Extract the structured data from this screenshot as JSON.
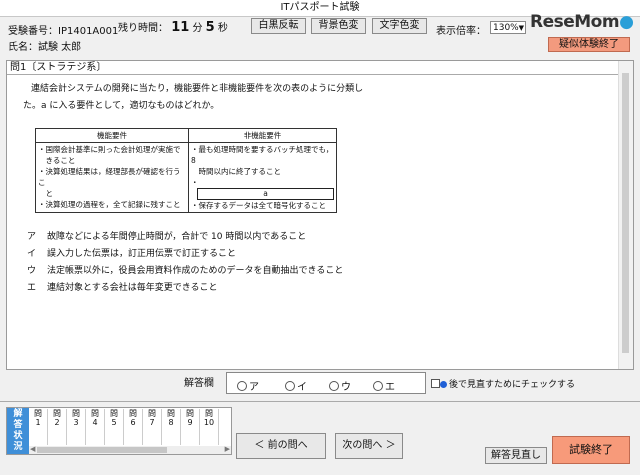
{
  "window": {
    "title": "ITパスポート試験"
  },
  "header": {
    "exam_id_label": "受験番号：",
    "exam_id_value": "IP1401A001",
    "time_label": "残り時間：",
    "minutes": "11",
    "minutes_unit": "分",
    "seconds": "5",
    "seconds_unit": "秒",
    "name_label": "氏名：",
    "name_value": "試験 太郎",
    "invert_button": "白黒反転",
    "bgcolor_button": "背景色変",
    "textcolor_button": "文字色変",
    "zoom_label": "表示倍率：",
    "zoom_value": "130%",
    "end_mock_button": "疑似体験終了",
    "watermark": "ReseMom"
  },
  "question": {
    "title": "問1〔ストラテジ系〕",
    "line1": "連結会計システムの開発に当たり，機能要件と非機能要件を次の表のように分類し",
    "line2": "た。a に入る要件として，適切なものはどれか。",
    "table": {
      "col1": "機能要件",
      "col2": "非機能要件",
      "func": [
        "・国際会計基準に則った会計処理が実施で",
        "　きること",
        "・決算処理結果は，経理部長が確認を行うこ",
        "　と",
        "・決算処理の過程を，全て記録に残すこと"
      ],
      "nonfunc": [
        "・最も処理時間を要するバッチ処理でも，8",
        "　時間以内に終了すること",
        "・保存するデータは全て暗号化すること"
      ],
      "blank_bullet": "・",
      "blank_label": "a"
    },
    "choices": [
      {
        "key": "ア",
        "text": "故障などによる年間停止時間が，合計で 10 時間以内であること"
      },
      {
        "key": "イ",
        "text": "誤入力した伝票は，訂正用伝票で訂正すること"
      },
      {
        "key": "ウ",
        "text": "法定帳票以外に，役員会用資料作成のためのデータを自動抽出できること"
      },
      {
        "key": "エ",
        "text": "連結対象とする会社は毎年変更できること"
      }
    ]
  },
  "answer": {
    "label": "解答欄",
    "options": [
      "ア",
      "イ",
      "ウ",
      "エ"
    ],
    "review_checkbox_label": "後で見直すためにチェックする"
  },
  "status_panel": {
    "label": [
      "解",
      "答",
      "状",
      "況"
    ],
    "question_word": "問",
    "numbers": [
      "1",
      "2",
      "3",
      "4",
      "5",
      "6",
      "7",
      "8",
      "9",
      "10"
    ]
  },
  "nav": {
    "prev": "＜ 前の問へ",
    "next": "次の問へ ＞",
    "review": "解答見直し",
    "finish": "試験終了"
  },
  "colors": {
    "finish_bg": "#f79a7a",
    "status_label_bg": "#3f8fd8",
    "end_mock_bg": "#f39a7e"
  }
}
